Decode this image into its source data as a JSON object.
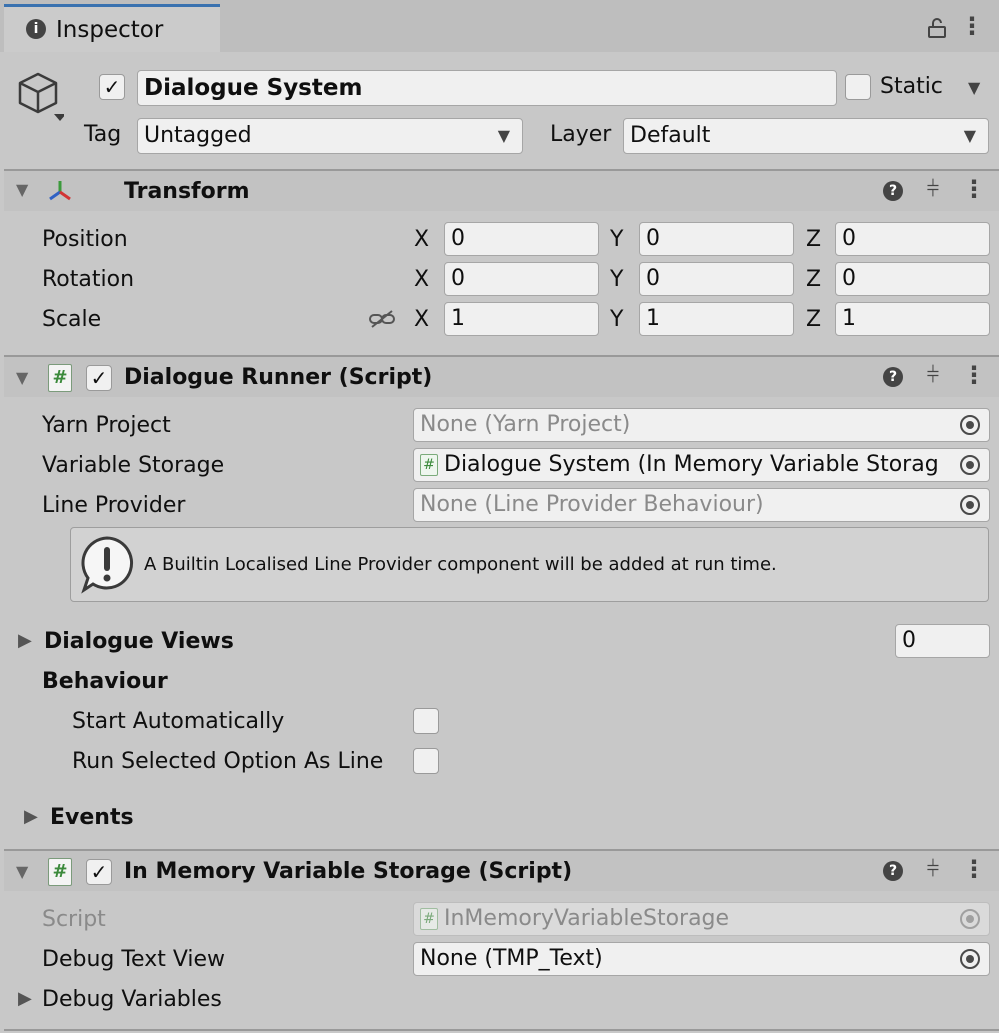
{
  "tab": {
    "title": "Inspector",
    "info_icon": "info-icon",
    "lock_icon": "lock-icon",
    "menu_icon": "more-icon"
  },
  "gameobject": {
    "active": "✓",
    "name": "Dialogue System",
    "static_label": "Static",
    "tag_label": "Tag",
    "tag_value": "Untagged",
    "layer_label": "Layer",
    "layer_value": "Default"
  },
  "transform": {
    "title": "Transform",
    "rows": [
      {
        "label": "Position",
        "x": "0",
        "y": "0",
        "z": "0"
      },
      {
        "label": "Rotation",
        "x": "0",
        "y": "0",
        "z": "0"
      },
      {
        "label": "Scale",
        "x": "1",
        "y": "1",
        "z": "1"
      }
    ],
    "axis_x": "X",
    "axis_y": "Y",
    "axis_z": "Z"
  },
  "dialogue_runner": {
    "title": "Dialogue Runner (Script)",
    "enabled": "✓",
    "yarn_project_label": "Yarn Project",
    "yarn_project_value": "None (Yarn Project)",
    "variable_storage_label": "Variable Storage",
    "variable_storage_value": "Dialogue System (In Memory Variable Storag",
    "line_provider_label": "Line Provider",
    "line_provider_value": "None (Line Provider Behaviour)",
    "help_text": "A Builtin Localised Line Provider component will be added at run time.",
    "dialogue_views_label": "Dialogue Views",
    "dialogue_views_count": "0",
    "behaviour_label": "Behaviour",
    "start_auto_label": "Start Automatically",
    "run_selected_label": "Run Selected Option As Line",
    "events_label": "Events"
  },
  "memory_storage": {
    "title": "In Memory Variable Storage (Script)",
    "enabled": "✓",
    "script_label": "Script",
    "script_value": "InMemoryVariableStorage",
    "debug_text_view_label": "Debug Text View",
    "debug_text_view_value": "None (TMP_Text)",
    "debug_variables_label": "Debug Variables"
  },
  "glyphs": {
    "foldout_open": "▼",
    "foldout_closed": "▶",
    "dropdown": "▼",
    "help": "?",
    "settings": "⫩",
    "more": "⋮",
    "hash": "#",
    "lock": "🔓",
    "info": "i",
    "warning": "!",
    "unlink": "⛓"
  },
  "colors": {
    "tab_accent": "#3a72b0",
    "script_icon_green": "#3c8a3c"
  }
}
